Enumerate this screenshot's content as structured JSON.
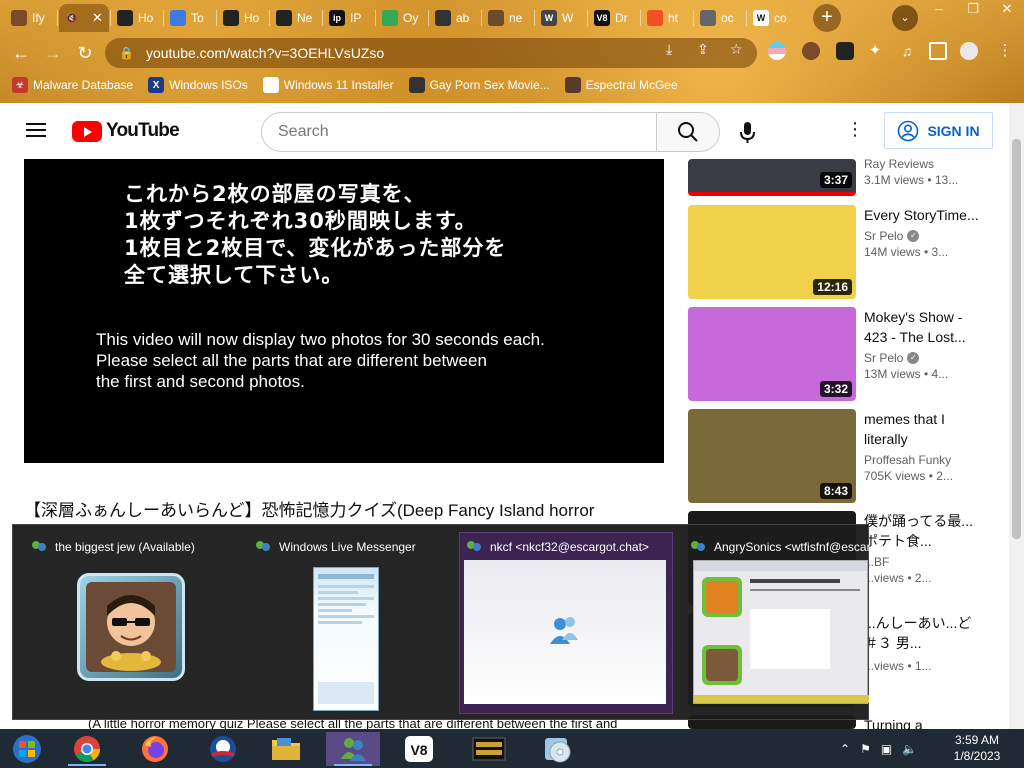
{
  "tabs": [
    {
      "label": "Ify",
      "fav_color": "#7a4a2a",
      "fav_text": ""
    },
    {
      "label": "",
      "fav_color": "transparent",
      "fav_text": "🔇",
      "active": true
    },
    {
      "label": "Ho",
      "fav_color": "#222222",
      "fav_text": ""
    },
    {
      "label": "To",
      "fav_color": "#3c7ae0",
      "fav_text": ""
    },
    {
      "label": "Ho",
      "fav_color": "#222222",
      "fav_text": ""
    },
    {
      "label": "Ne",
      "fav_color": "#222222",
      "fav_text": ""
    },
    {
      "label": "IP",
      "fav_color": "#111111",
      "fav_text": "ip"
    },
    {
      "label": "Oy",
      "fav_color": "#34a853",
      "fav_text": ""
    },
    {
      "label": "ab",
      "fav_color": "#333333",
      "fav_text": ""
    },
    {
      "label": "ne",
      "fav_color": "#6b4a2e",
      "fav_text": ""
    },
    {
      "label": "W",
      "fav_color": "#444444",
      "fav_text": "W"
    },
    {
      "label": "Dr",
      "fav_color": "#111111",
      "fav_text": "V8"
    },
    {
      "label": "ht",
      "fav_color": "#f25022",
      "fav_text": ""
    },
    {
      "label": "oc",
      "fav_color": "#666666",
      "fav_text": ""
    },
    {
      "label": "co",
      "fav_color": "#ffffff",
      "fav_text": "W"
    }
  ],
  "toolbar": {
    "url": "youtube.com/watch?v=3OEHLVsUZso",
    "new_tab": "+",
    "tab_search": "⌄",
    "win_min": "–",
    "win_max": "❐",
    "win_close": "✕"
  },
  "bookmarks": [
    {
      "label": "Malware Database",
      "fav_color": "#c0392b",
      "fav_text": "☣"
    },
    {
      "label": "Windows ISOs",
      "fav_color": "#1d3a8a",
      "fav_text": "X"
    },
    {
      "label": "Windows 11 Installer",
      "fav_color": "#ffffff",
      "fav_text": ""
    },
    {
      "label": "Gay Porn Sex Movie...",
      "fav_color": "#333333",
      "fav_text": ""
    },
    {
      "label": "Espectral McGee",
      "fav_color": "#5a3a2a",
      "fav_text": ""
    }
  ],
  "youtube": {
    "logo_text": "YouTube",
    "search_placeholder": "Search",
    "signin_label": "SIGN IN"
  },
  "video": {
    "jp_caption": "これから2枚の部屋の写真を、\n1枚ずつそれぞれ30秒間映します。\n1枚目と2枚目で、変化があった部分を\n全て選択して下さい。",
    "en_caption": "This video will now display two photos for 30 seconds each.\nPlease select all the parts that are different between\nthe first and second photos.",
    "title": "【深層ふぁんしーあいらんど】恐怖記憶力クイズ(Deep Fancy Island horror",
    "description_snippet": "(A little horror memory quiz Please select all the parts that are different between the first and"
  },
  "sidebar": [
    {
      "title": "",
      "channel": "Ray Reviews",
      "stats": "3.1M views • 13...",
      "duration": "3:37",
      "thumb": "#3b3b45",
      "verified": false
    },
    {
      "title": "Every StoryTime...",
      "channel": "Sr Pelo",
      "stats": "14M views • 3...",
      "duration": "12:16",
      "thumb": "#f2d14a",
      "verified": true
    },
    {
      "title": "Mokey's Show - 423 - The Lost...",
      "channel": "Sr Pelo",
      "stats": "13M views • 4...",
      "duration": "3:32",
      "thumb": "#c56ad8",
      "verified": true
    },
    {
      "title": "memes that I literally",
      "channel": "Proffesah Funky",
      "stats": "705K views • 2...",
      "duration": "8:43",
      "thumb": "#7a6a3a",
      "verified": false
    },
    {
      "title": "僕が踊ってる最...ポテト食...",
      "channel": "...BF",
      "stats": "...views • 2...",
      "duration": "",
      "thumb": "#1a1a1a",
      "verified": false
    },
    {
      "title": "...んしーあい...ど＃３ 男...",
      "channel": "",
      "stats": "...views • 1...",
      "duration": "",
      "thumb": "#1a1a1a",
      "verified": false
    },
    {
      "title": "Turning a",
      "channel": "",
      "stats": "",
      "duration": "",
      "thumb": "#1a1a1a",
      "verified": false
    }
  ],
  "peek": [
    {
      "title": "the biggest jew (Available)"
    },
    {
      "title": "Windows Live Messenger"
    },
    {
      "title": "nkcf <nkcf32@escargot.chat>",
      "active": true
    },
    {
      "title": "AngrySonics <wtfisfnf@escargo..."
    }
  ],
  "taskbar": {
    "apps": [
      "start",
      "chrome",
      "firefox",
      "obama",
      "explorer",
      "messenger",
      "v8",
      "warning",
      "disc"
    ],
    "time": "3:59 AM",
    "date": "1/8/2023"
  }
}
